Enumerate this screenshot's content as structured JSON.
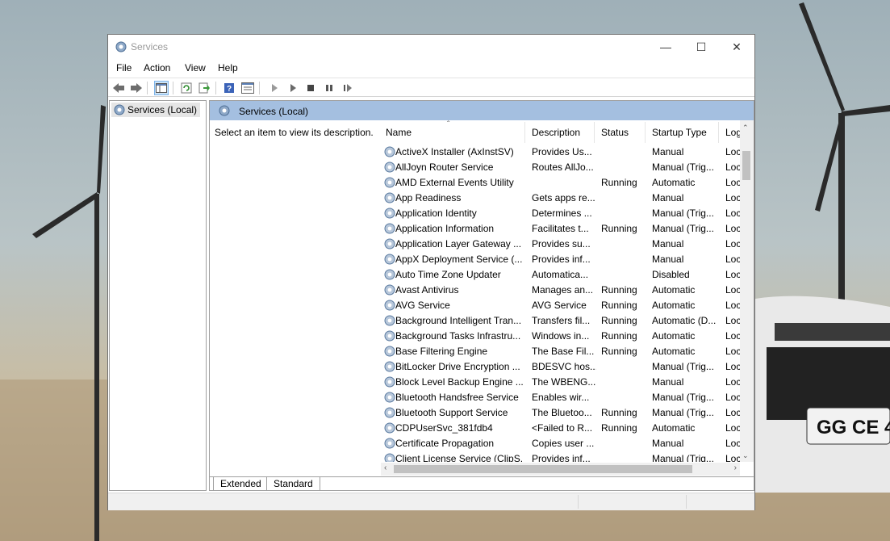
{
  "window": {
    "title": "Services"
  },
  "menu": [
    "File",
    "Action",
    "View",
    "Help"
  ],
  "toolbar_icons": [
    "back-arrow-icon",
    "forward-arrow-icon",
    "console-tree-icon",
    "refresh-icon",
    "export-list-icon",
    "help-icon",
    "properties-icon",
    "start-service-icon",
    "start-service-alt-icon",
    "stop-service-icon",
    "pause-service-icon",
    "restart-service-icon"
  ],
  "tree": {
    "item": "Services (Local)"
  },
  "detail": {
    "header": "Services (Local)",
    "description": "Select an item to view its description."
  },
  "columns": [
    "Name",
    "Description",
    "Status",
    "Startup Type",
    "Log"
  ],
  "rows": [
    [
      "ActiveX Installer (AxInstSV)",
      "Provides Us...",
      "",
      "Manual",
      "Loc"
    ],
    [
      "AllJoyn Router Service",
      "Routes AllJo...",
      "",
      "Manual (Trig...",
      "Loc"
    ],
    [
      "AMD External Events Utility",
      "",
      "Running",
      "Automatic",
      "Loc"
    ],
    [
      "App Readiness",
      "Gets apps re...",
      "",
      "Manual",
      "Loc"
    ],
    [
      "Application Identity",
      "Determines ...",
      "",
      "Manual (Trig...",
      "Loc"
    ],
    [
      "Application Information",
      "Facilitates t...",
      "Running",
      "Manual (Trig...",
      "Loc"
    ],
    [
      "Application Layer Gateway ...",
      "Provides su...",
      "",
      "Manual",
      "Loc"
    ],
    [
      "AppX Deployment Service (...",
      "Provides inf...",
      "",
      "Manual",
      "Loc"
    ],
    [
      "Auto Time Zone Updater",
      "Automatica...",
      "",
      "Disabled",
      "Loc"
    ],
    [
      "Avast Antivirus",
      "Manages an...",
      "Running",
      "Automatic",
      "Loc"
    ],
    [
      "AVG Service",
      "AVG Service",
      "Running",
      "Automatic",
      "Loc"
    ],
    [
      "Background Intelligent Tran...",
      "Transfers fil...",
      "Running",
      "Automatic (D...",
      "Loc"
    ],
    [
      "Background Tasks Infrastru...",
      "Windows in...",
      "Running",
      "Automatic",
      "Loc"
    ],
    [
      "Base Filtering Engine",
      "The Base Fil...",
      "Running",
      "Automatic",
      "Loc"
    ],
    [
      "BitLocker Drive Encryption ...",
      "BDESVC hos...",
      "",
      "Manual (Trig...",
      "Loc"
    ],
    [
      "Block Level Backup Engine ...",
      "The WBENG...",
      "",
      "Manual",
      "Loc"
    ],
    [
      "Bluetooth Handsfree Service",
      "Enables wir...",
      "",
      "Manual (Trig...",
      "Loc"
    ],
    [
      "Bluetooth Support Service",
      "The Bluetoo...",
      "Running",
      "Manual (Trig...",
      "Loc"
    ],
    [
      "CDPUserSvc_381fdb4",
      "<Failed to R...",
      "Running",
      "Automatic",
      "Loc"
    ],
    [
      "Certificate Propagation",
      "Copies user ...",
      "",
      "Manual",
      "Loc"
    ],
    [
      "Client License Service (ClipS...",
      "Provides inf...",
      "",
      "Manual (Trig...",
      "Loc"
    ]
  ],
  "tabs": [
    "Extended",
    "Standard"
  ]
}
